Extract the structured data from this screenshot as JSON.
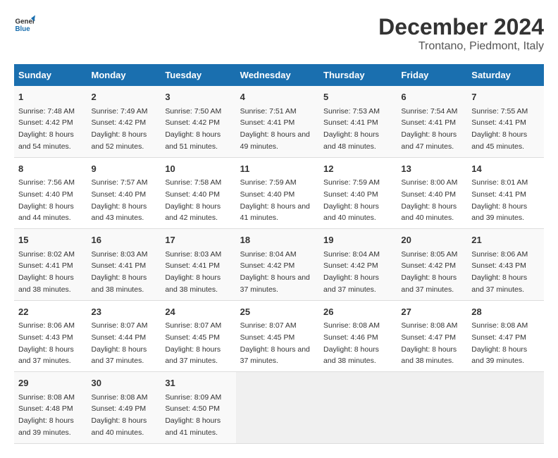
{
  "header": {
    "logo_general": "General",
    "logo_blue": "Blue",
    "title": "December 2024",
    "subtitle": "Trontano, Piedmont, Italy"
  },
  "columns": [
    "Sunday",
    "Monday",
    "Tuesday",
    "Wednesday",
    "Thursday",
    "Friday",
    "Saturday"
  ],
  "weeks": [
    [
      {
        "day": "1",
        "sunrise": "Sunrise: 7:48 AM",
        "sunset": "Sunset: 4:42 PM",
        "daylight": "Daylight: 8 hours and 54 minutes."
      },
      {
        "day": "2",
        "sunrise": "Sunrise: 7:49 AM",
        "sunset": "Sunset: 4:42 PM",
        "daylight": "Daylight: 8 hours and 52 minutes."
      },
      {
        "day": "3",
        "sunrise": "Sunrise: 7:50 AM",
        "sunset": "Sunset: 4:42 PM",
        "daylight": "Daylight: 8 hours and 51 minutes."
      },
      {
        "day": "4",
        "sunrise": "Sunrise: 7:51 AM",
        "sunset": "Sunset: 4:41 PM",
        "daylight": "Daylight: 8 hours and 49 minutes."
      },
      {
        "day": "5",
        "sunrise": "Sunrise: 7:53 AM",
        "sunset": "Sunset: 4:41 PM",
        "daylight": "Daylight: 8 hours and 48 minutes."
      },
      {
        "day": "6",
        "sunrise": "Sunrise: 7:54 AM",
        "sunset": "Sunset: 4:41 PM",
        "daylight": "Daylight: 8 hours and 47 minutes."
      },
      {
        "day": "7",
        "sunrise": "Sunrise: 7:55 AM",
        "sunset": "Sunset: 4:41 PM",
        "daylight": "Daylight: 8 hours and 45 minutes."
      }
    ],
    [
      {
        "day": "8",
        "sunrise": "Sunrise: 7:56 AM",
        "sunset": "Sunset: 4:40 PM",
        "daylight": "Daylight: 8 hours and 44 minutes."
      },
      {
        "day": "9",
        "sunrise": "Sunrise: 7:57 AM",
        "sunset": "Sunset: 4:40 PM",
        "daylight": "Daylight: 8 hours and 43 minutes."
      },
      {
        "day": "10",
        "sunrise": "Sunrise: 7:58 AM",
        "sunset": "Sunset: 4:40 PM",
        "daylight": "Daylight: 8 hours and 42 minutes."
      },
      {
        "day": "11",
        "sunrise": "Sunrise: 7:59 AM",
        "sunset": "Sunset: 4:40 PM",
        "daylight": "Daylight: 8 hours and 41 minutes."
      },
      {
        "day": "12",
        "sunrise": "Sunrise: 7:59 AM",
        "sunset": "Sunset: 4:40 PM",
        "daylight": "Daylight: 8 hours and 40 minutes."
      },
      {
        "day": "13",
        "sunrise": "Sunrise: 8:00 AM",
        "sunset": "Sunset: 4:40 PM",
        "daylight": "Daylight: 8 hours and 40 minutes."
      },
      {
        "day": "14",
        "sunrise": "Sunrise: 8:01 AM",
        "sunset": "Sunset: 4:41 PM",
        "daylight": "Daylight: 8 hours and 39 minutes."
      }
    ],
    [
      {
        "day": "15",
        "sunrise": "Sunrise: 8:02 AM",
        "sunset": "Sunset: 4:41 PM",
        "daylight": "Daylight: 8 hours and 38 minutes."
      },
      {
        "day": "16",
        "sunrise": "Sunrise: 8:03 AM",
        "sunset": "Sunset: 4:41 PM",
        "daylight": "Daylight: 8 hours and 38 minutes."
      },
      {
        "day": "17",
        "sunrise": "Sunrise: 8:03 AM",
        "sunset": "Sunset: 4:41 PM",
        "daylight": "Daylight: 8 hours and 38 minutes."
      },
      {
        "day": "18",
        "sunrise": "Sunrise: 8:04 AM",
        "sunset": "Sunset: 4:42 PM",
        "daylight": "Daylight: 8 hours and 37 minutes."
      },
      {
        "day": "19",
        "sunrise": "Sunrise: 8:04 AM",
        "sunset": "Sunset: 4:42 PM",
        "daylight": "Daylight: 8 hours and 37 minutes."
      },
      {
        "day": "20",
        "sunrise": "Sunrise: 8:05 AM",
        "sunset": "Sunset: 4:42 PM",
        "daylight": "Daylight: 8 hours and 37 minutes."
      },
      {
        "day": "21",
        "sunrise": "Sunrise: 8:06 AM",
        "sunset": "Sunset: 4:43 PM",
        "daylight": "Daylight: 8 hours and 37 minutes."
      }
    ],
    [
      {
        "day": "22",
        "sunrise": "Sunrise: 8:06 AM",
        "sunset": "Sunset: 4:43 PM",
        "daylight": "Daylight: 8 hours and 37 minutes."
      },
      {
        "day": "23",
        "sunrise": "Sunrise: 8:07 AM",
        "sunset": "Sunset: 4:44 PM",
        "daylight": "Daylight: 8 hours and 37 minutes."
      },
      {
        "day": "24",
        "sunrise": "Sunrise: 8:07 AM",
        "sunset": "Sunset: 4:45 PM",
        "daylight": "Daylight: 8 hours and 37 minutes."
      },
      {
        "day": "25",
        "sunrise": "Sunrise: 8:07 AM",
        "sunset": "Sunset: 4:45 PM",
        "daylight": "Daylight: 8 hours and 37 minutes."
      },
      {
        "day": "26",
        "sunrise": "Sunrise: 8:08 AM",
        "sunset": "Sunset: 4:46 PM",
        "daylight": "Daylight: 8 hours and 38 minutes."
      },
      {
        "day": "27",
        "sunrise": "Sunrise: 8:08 AM",
        "sunset": "Sunset: 4:47 PM",
        "daylight": "Daylight: 8 hours and 38 minutes."
      },
      {
        "day": "28",
        "sunrise": "Sunrise: 8:08 AM",
        "sunset": "Sunset: 4:47 PM",
        "daylight": "Daylight: 8 hours and 39 minutes."
      }
    ],
    [
      {
        "day": "29",
        "sunrise": "Sunrise: 8:08 AM",
        "sunset": "Sunset: 4:48 PM",
        "daylight": "Daylight: 8 hours and 39 minutes."
      },
      {
        "day": "30",
        "sunrise": "Sunrise: 8:08 AM",
        "sunset": "Sunset: 4:49 PM",
        "daylight": "Daylight: 8 hours and 40 minutes."
      },
      {
        "day": "31",
        "sunrise": "Sunrise: 8:09 AM",
        "sunset": "Sunset: 4:50 PM",
        "daylight": "Daylight: 8 hours and 41 minutes."
      },
      null,
      null,
      null,
      null
    ]
  ]
}
